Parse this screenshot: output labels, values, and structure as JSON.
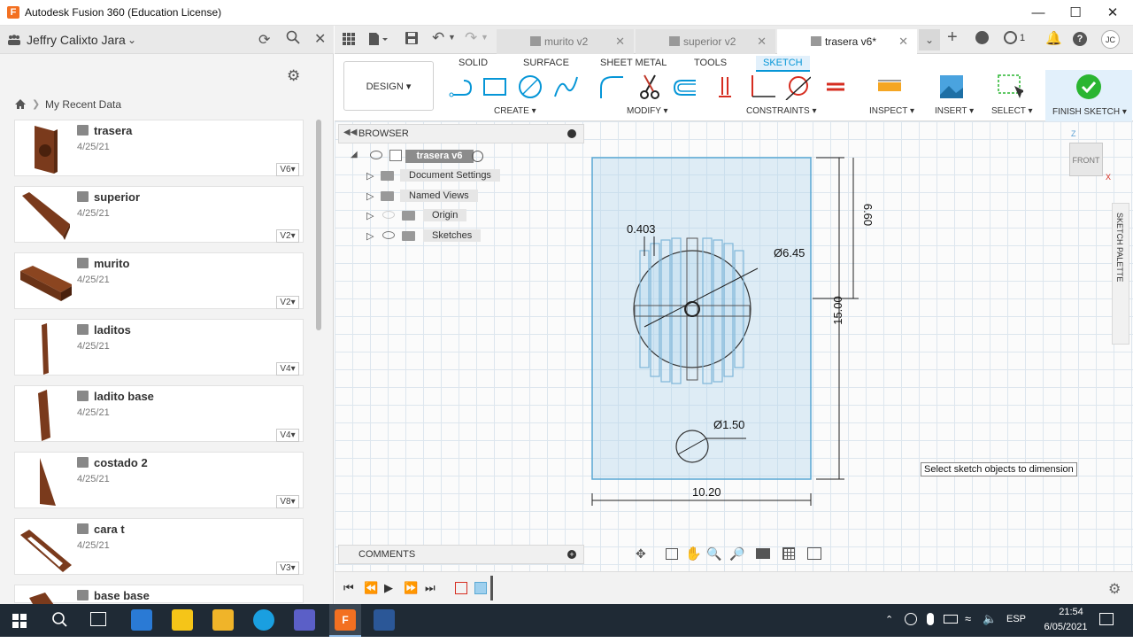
{
  "window": {
    "title": "Autodesk Fusion 360 (Education License)",
    "logo": "F"
  },
  "data_panel": {
    "user": "Jeffry Calixto Jara",
    "breadcrumb": "My Recent Data",
    "items": [
      {
        "name": "trasera",
        "date": "4/25/21",
        "version": "V6"
      },
      {
        "name": "superior",
        "date": "4/25/21",
        "version": "V2"
      },
      {
        "name": "murito",
        "date": "4/25/21",
        "version": "V2"
      },
      {
        "name": "laditos",
        "date": "4/25/21",
        "version": "V4"
      },
      {
        "name": "ladito base",
        "date": "4/25/21",
        "version": "V4"
      },
      {
        "name": "costado 2",
        "date": "4/25/21",
        "version": "V8"
      },
      {
        "name": "cara t",
        "date": "4/25/21",
        "version": "V3"
      },
      {
        "name": "base base",
        "date": "",
        "version": ""
      }
    ]
  },
  "doc_tabs": [
    {
      "label": "murito v2",
      "active": false
    },
    {
      "label": "superior v2",
      "active": false
    },
    {
      "label": "trasera v6*",
      "active": true
    }
  ],
  "header": {
    "notifications": "1",
    "user_initials": "JC"
  },
  "ribbon": {
    "workspace": "DESIGN",
    "tabs": [
      "SOLID",
      "SURFACE",
      "SHEET METAL",
      "TOOLS",
      "SKETCH"
    ],
    "groups": {
      "create": "CREATE",
      "modify": "MODIFY",
      "constraints": "CONSTRAINTS",
      "inspect": "INSPECT",
      "insert": "INSERT",
      "select": "SELECT",
      "finish": "FINISH SKETCH"
    }
  },
  "browser": {
    "title": "BROWSER",
    "root": "trasera v6",
    "nodes": [
      "Document Settings",
      "Named Views",
      "Origin",
      "Sketches"
    ]
  },
  "comments": {
    "title": "COMMENTS"
  },
  "sketch": {
    "dim_top": "0.403",
    "dim_circle_big": "Ø6.45",
    "dim_circle_small": "Ø1.50",
    "dim_width": "10.20",
    "dim_height": "15.00",
    "dim_partial": "6.60"
  },
  "tooltip": "Select sketch objects to dimension",
  "viewcube": {
    "face": "FRONT",
    "axis_z": "Z",
    "axis_x": "X"
  },
  "sketch_palette": "SKETCH PALETTE",
  "taskbar": {
    "lang": "ESP",
    "time": "21:54",
    "date": "6/05/2021"
  },
  "colors": {
    "accent": "#0696d7",
    "finish": "#2ab531",
    "brand": "#f37021"
  }
}
